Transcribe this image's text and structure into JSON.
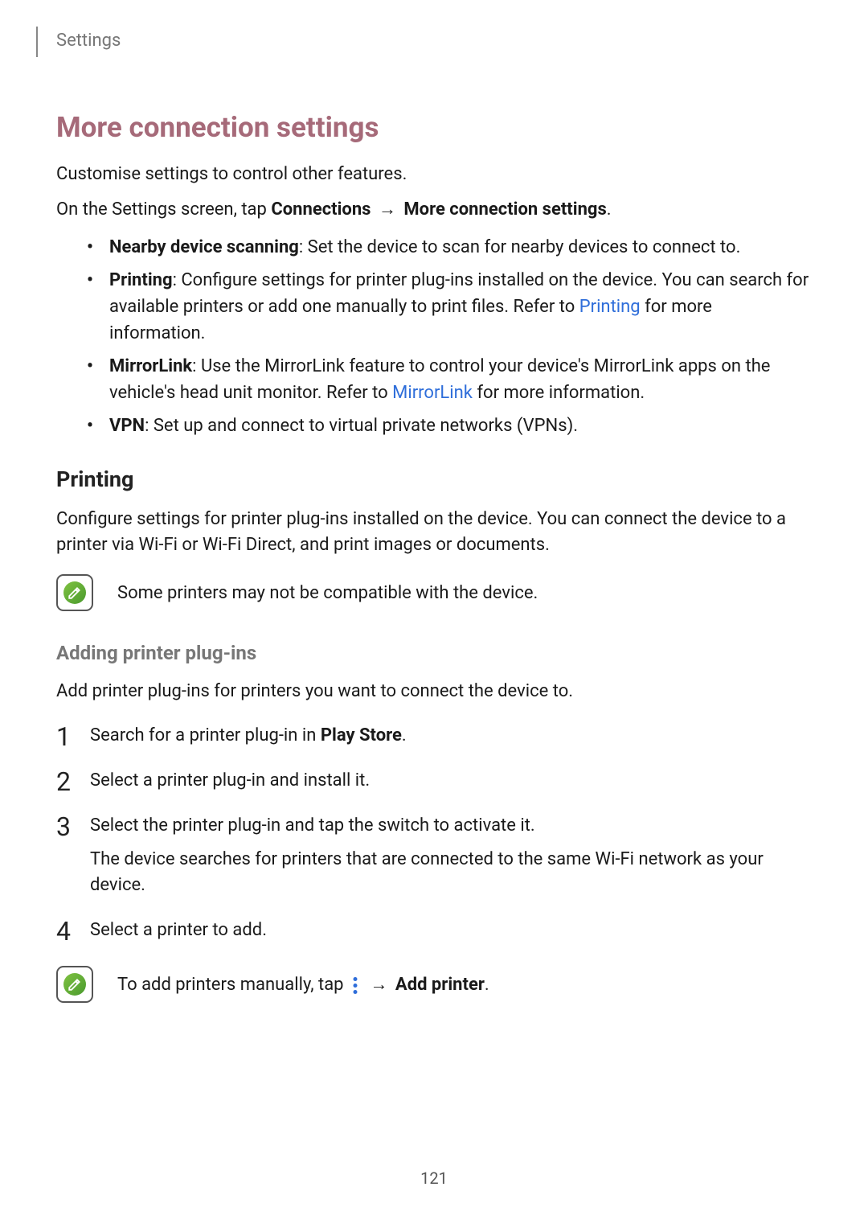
{
  "header": {
    "breadcrumb": "Settings"
  },
  "title": "More connection settings",
  "intro": "Customise settings to control other features.",
  "nav_prefix": "On the Settings screen, tap ",
  "nav_item1": "Connections",
  "nav_arrow": "→",
  "nav_item2": "More connection settings",
  "nav_suffix": ".",
  "bullets": {
    "b1_label": "Nearby device scanning",
    "b1_text": ": Set the device to scan for nearby devices to connect to.",
    "b2_label": "Printing",
    "b2_text1": ": Configure settings for printer plug-ins installed on the device. You can search for available printers or add one manually to print files. Refer to ",
    "b2_link": "Printing",
    "b2_text2": " for more information.",
    "b3_label": "MirrorLink",
    "b3_text1": ": Use the MirrorLink feature to control your device's MirrorLink apps on the vehicle's head unit monitor. Refer to ",
    "b3_link": "MirrorLink",
    "b3_text2": " for more information.",
    "b4_label": "VPN",
    "b4_text": ": Set up and connect to virtual private networks (VPNs)."
  },
  "printing": {
    "heading": "Printing",
    "desc": "Configure settings for printer plug-ins installed on the device. You can connect the device to a printer via Wi-Fi or Wi-Fi Direct, and print images or documents.",
    "note": "Some printers may not be compatible with the device."
  },
  "plugin": {
    "heading": "Adding printer plug-ins",
    "desc": "Add printer plug-ins for printers you want to connect the device to.",
    "step1_a": "Search for a printer plug-in in ",
    "step1_b": "Play Store",
    "step1_c": ".",
    "step2": "Select a printer plug-in and install it.",
    "step3_a": "Select the printer plug-in and tap the switch to activate it.",
    "step3_b": "The device searches for printers that are connected to the same Wi-Fi network as your device.",
    "step4": "Select a printer to add.",
    "note_a": "To add printers manually, tap ",
    "note_arrow": "→",
    "note_b": "Add printer",
    "note_c": "."
  },
  "page_number": "121"
}
